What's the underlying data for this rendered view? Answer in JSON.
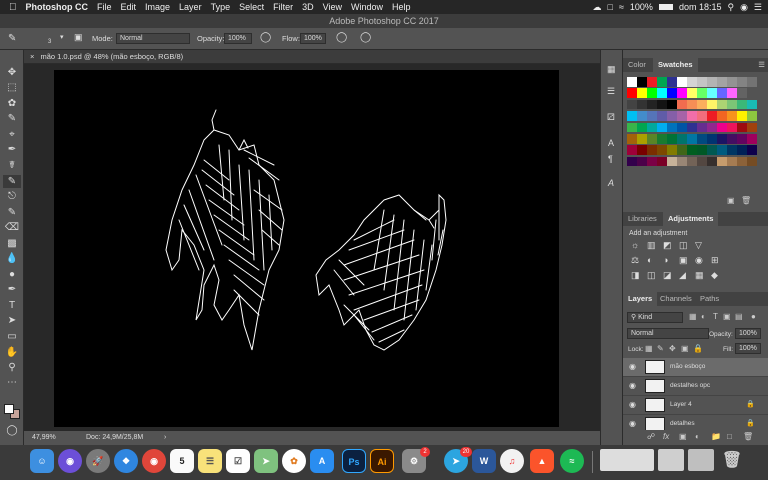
{
  "menubar": {
    "apple_icon": "apple-icon",
    "app_name": "Photoshop CC",
    "items": [
      "File",
      "Edit",
      "Image",
      "Layer",
      "Type",
      "Select",
      "Filter",
      "3D",
      "View",
      "Window",
      "Help"
    ],
    "battery": "100%",
    "clock": "dom 18:15"
  },
  "window_title": "Adobe Photoshop CC 2017",
  "options": {
    "brush_size": "3",
    "mode_label": "Mode:",
    "mode_value": "Normal",
    "opacity_label": "Opacity:",
    "opacity_value": "100%",
    "flow_label": "Flow:",
    "flow_value": "100%"
  },
  "document": {
    "tab_label": "mão 1.0.psd @ 48% (mão esboço, RGB/8)",
    "zoom": "47,99%",
    "doc_info": "Doc: 24,9M/25,8M"
  },
  "swatches_panel": {
    "tabs": [
      "Color",
      "Swatches"
    ],
    "active_tab": "Swatches",
    "colors": [
      "#ffffff",
      "#000000",
      "#ed1c24",
      "#00a651",
      "#2e3192",
      "#ffffff",
      "#d4d4d4",
      "#c4c4c4",
      "#b3b3b3",
      "#a3a3a3",
      "#939393",
      "#838383",
      "#737373",
      "#ff0000",
      "#ffff00",
      "#00ff00",
      "#00ffff",
      "#0000ff",
      "#ff00ff",
      "#ffff66",
      "#66ff66",
      "#66ffff",
      "#6666ff",
      "#ff66ff",
      "#636363",
      "#535353",
      "#434343",
      "#333333",
      "#232323",
      "#131313",
      "#000000",
      "#f26c4f",
      "#f68e56",
      "#fbaf5d",
      "#fff568",
      "#acd373",
      "#7cc576",
      "#3bb878",
      "#1abbb4",
      "#00bff3",
      "#438ccb",
      "#5574b9",
      "#605ca8",
      "#855fa8",
      "#a763a8",
      "#f06ea9",
      "#f26d7d",
      "#ed1c24",
      "#f26522",
      "#f7941d",
      "#fff200",
      "#8dc63f",
      "#39b54a",
      "#00a651",
      "#00a99d",
      "#00aeef",
      "#0072bc",
      "#0054a6",
      "#2e3192",
      "#662d91",
      "#92278f",
      "#ec008c",
      "#ed145b",
      "#9e0b0f",
      "#a0410d",
      "#a3620a",
      "#aba000",
      "#598527",
      "#197b30",
      "#007236",
      "#00746b",
      "#0076a3",
      "#004a80",
      "#003471",
      "#1b1464",
      "#440e62",
      "#630460",
      "#9e005d",
      "#9e0039",
      "#790000",
      "#7b2e00",
      "#7d4900",
      "#827b00",
      "#406618",
      "#005e20",
      "#005826",
      "#005952",
      "#005b7f",
      "#003663",
      "#002157",
      "#0d004c",
      "#32004b",
      "#4b0049",
      "#7b0046",
      "#7a0026",
      "#c7b299",
      "#998675",
      "#736357",
      "#534741",
      "#362f2d",
      "#c69c6d",
      "#a67c52",
      "#8c6239",
      "#754c24"
    ]
  },
  "adjustments_panel": {
    "tabs": [
      "Libraries",
      "Adjustments"
    ],
    "active_tab": "Adjustments",
    "heading": "Add an adjustment"
  },
  "layers_panel": {
    "tabs": [
      "Layers",
      "Channels",
      "Paths"
    ],
    "active_tab": "Layers",
    "filter_kind": "Kind",
    "blend_mode": "Normal",
    "opacity_label": "Opacity:",
    "opacity_value": "100%",
    "lock_label": "Lock:",
    "fill_label": "Fill:",
    "fill_value": "100%",
    "layers": [
      {
        "name": "mão esboço",
        "selected": true,
        "locked": false
      },
      {
        "name": "destalhes opc",
        "selected": false,
        "locked": false
      },
      {
        "name": "Layer 4",
        "selected": false,
        "locked": true
      },
      {
        "name": "detalhes",
        "selected": false,
        "locked": true
      }
    ]
  },
  "dock": {
    "apps": [
      "finder-icon",
      "siri-icon",
      "launchpad-icon",
      "safari-icon",
      "chrome-icon",
      "calendar-icon",
      "notes-icon",
      "reminders-icon",
      "maps-icon",
      "photos-icon",
      "appstore-icon",
      "photoshop-icon",
      "illustrator-icon",
      "system-preferences-icon",
      "telegram-icon",
      "word-icon",
      "music-icon",
      "brave-icon",
      "spotify-icon",
      "trash-icon"
    ],
    "calendar_day": "5",
    "photoshop_label": "Ps",
    "illustrator_label": "Ai",
    "word_label": "W",
    "sysprefs_badge": "2",
    "telegram_badge": "20"
  },
  "colors": {
    "ui_panel": "#535353",
    "ui_dark": "#3c3c3c",
    "canvas": "#000000",
    "selection": "#6b6b6b"
  }
}
